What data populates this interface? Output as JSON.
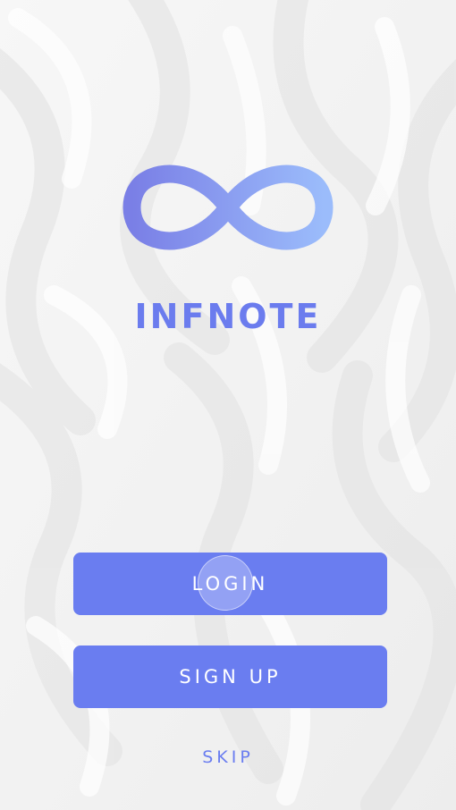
{
  "app": {
    "brand_name": "INFNOTE",
    "logo_icon": "infinity-icon",
    "accent_color": "#6a7df0",
    "logo_gradient": [
      "#7a7fe6",
      "#9bbcfb"
    ]
  },
  "actions": {
    "login_label": "LOGIN",
    "signup_label": "SIGN UP",
    "skip_label": "SKIP"
  }
}
